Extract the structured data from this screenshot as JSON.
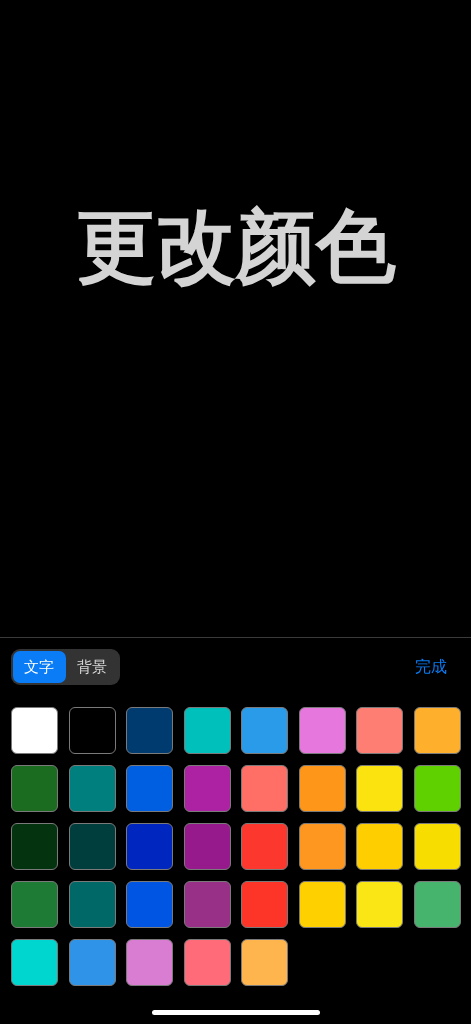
{
  "preview": {
    "text": "更改颜色"
  },
  "segments": [
    {
      "label": "文字",
      "selected": true
    },
    {
      "label": "背景",
      "selected": false
    }
  ],
  "done_button": "完成",
  "swatches": [
    {
      "color": "#ffffff"
    },
    {
      "color": "#000000"
    },
    {
      "color": "#003b70"
    },
    {
      "color": "#00c0bb"
    },
    {
      "color": "#2a9be8"
    },
    {
      "color": "#e577dd"
    },
    {
      "color": "#ff7e73"
    },
    {
      "color": "#feaf2c"
    },
    {
      "color": "#1b6b20"
    },
    {
      "color": "#007f7f"
    },
    {
      "color": "#005fe0"
    },
    {
      "color": "#ad22a2"
    },
    {
      "color": "#ff6f66"
    },
    {
      "color": "#fe9719"
    },
    {
      "color": "#fbe30f"
    },
    {
      "color": "#60d100"
    },
    {
      "color": "#03330f"
    },
    {
      "color": "#003e3e"
    },
    {
      "color": "#0026c0"
    },
    {
      "color": "#971a8c"
    },
    {
      "color": "#fc382e"
    },
    {
      "color": "#fe971f"
    },
    {
      "color": "#fece00"
    },
    {
      "color": "#f8dd00"
    },
    {
      "color": "#1e7b35"
    },
    {
      "color": "#006866"
    },
    {
      "color": "#0055e3"
    },
    {
      "color": "#983088"
    },
    {
      "color": "#fd3528"
    },
    {
      "color": "#fed000"
    },
    {
      "color": "#fae614"
    },
    {
      "color": "#47b46e"
    },
    {
      "color": "#00d6d0"
    },
    {
      "color": "#2f94e8"
    },
    {
      "color": "#d97dd3"
    },
    {
      "color": "#ff6b79"
    },
    {
      "color": "#ffb54e"
    }
  ]
}
